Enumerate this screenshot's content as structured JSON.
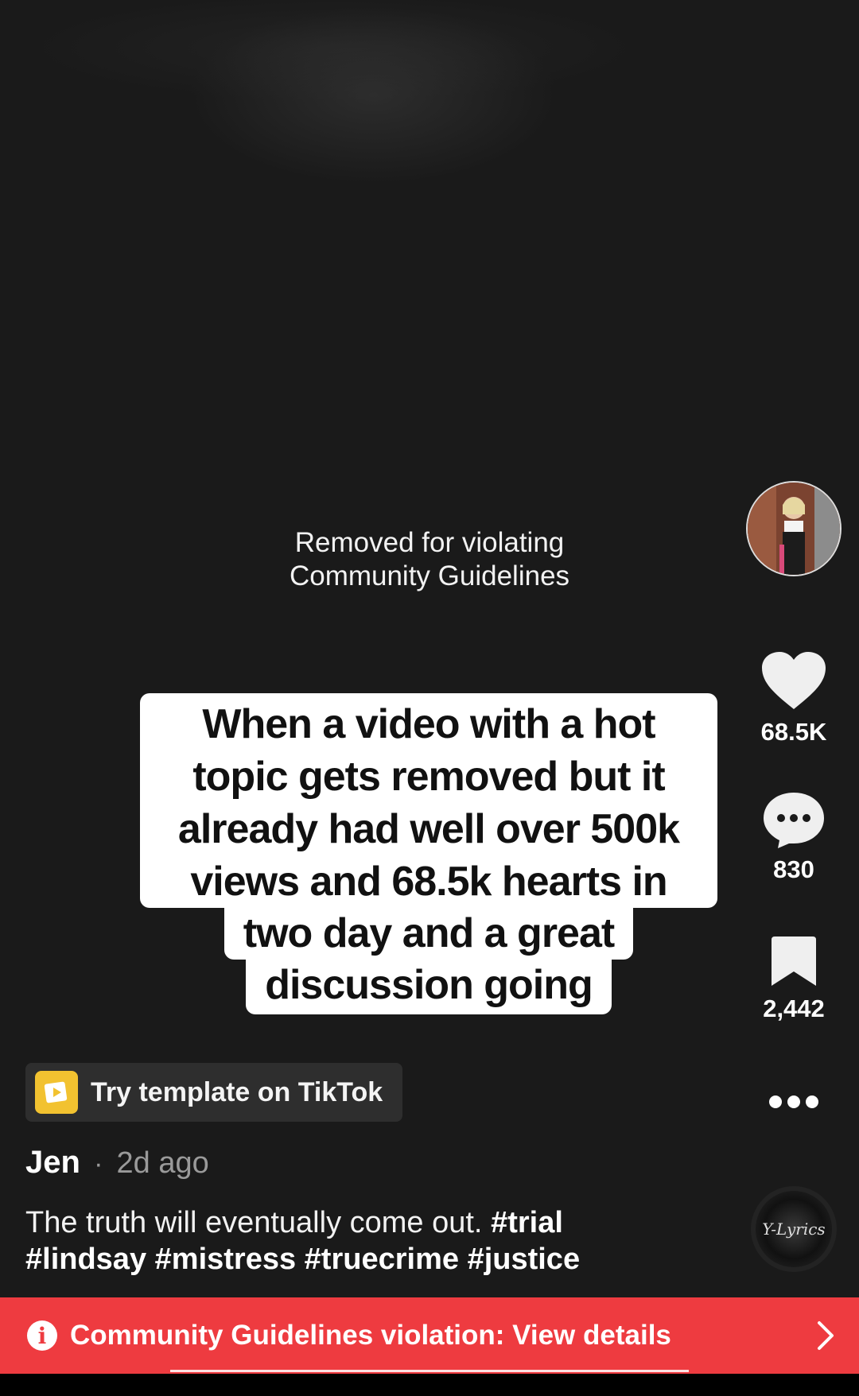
{
  "video": {
    "removed_message_line1": "Removed for violating",
    "removed_message_line2": "Community Guidelines"
  },
  "caption": {
    "lines": [
      "When a video with a hot",
      "topic gets removed but it",
      "already had well over 500k",
      "views and 68.5k hearts in",
      "two day and a great",
      "discussion going"
    ]
  },
  "actions": {
    "likes": "68.5K",
    "comments": "830",
    "saves": "2,442"
  },
  "template": {
    "label": "Try template on TikTok"
  },
  "post": {
    "author": "Jen",
    "separator": "·",
    "time": "2d ago",
    "text": "The truth will eventually come out.",
    "hashtags": [
      "#trial",
      "#lindsay",
      "#mistress",
      "#truecrime",
      "#justice"
    ]
  },
  "music": {
    "disc_label": "Y-Lyrics"
  },
  "violation_bar": {
    "label": "Community Guidelines violation: View details"
  },
  "colors": {
    "background": "#1a1a1a",
    "violation_red": "#ee3b40",
    "template_yellow": "#f2c230"
  }
}
